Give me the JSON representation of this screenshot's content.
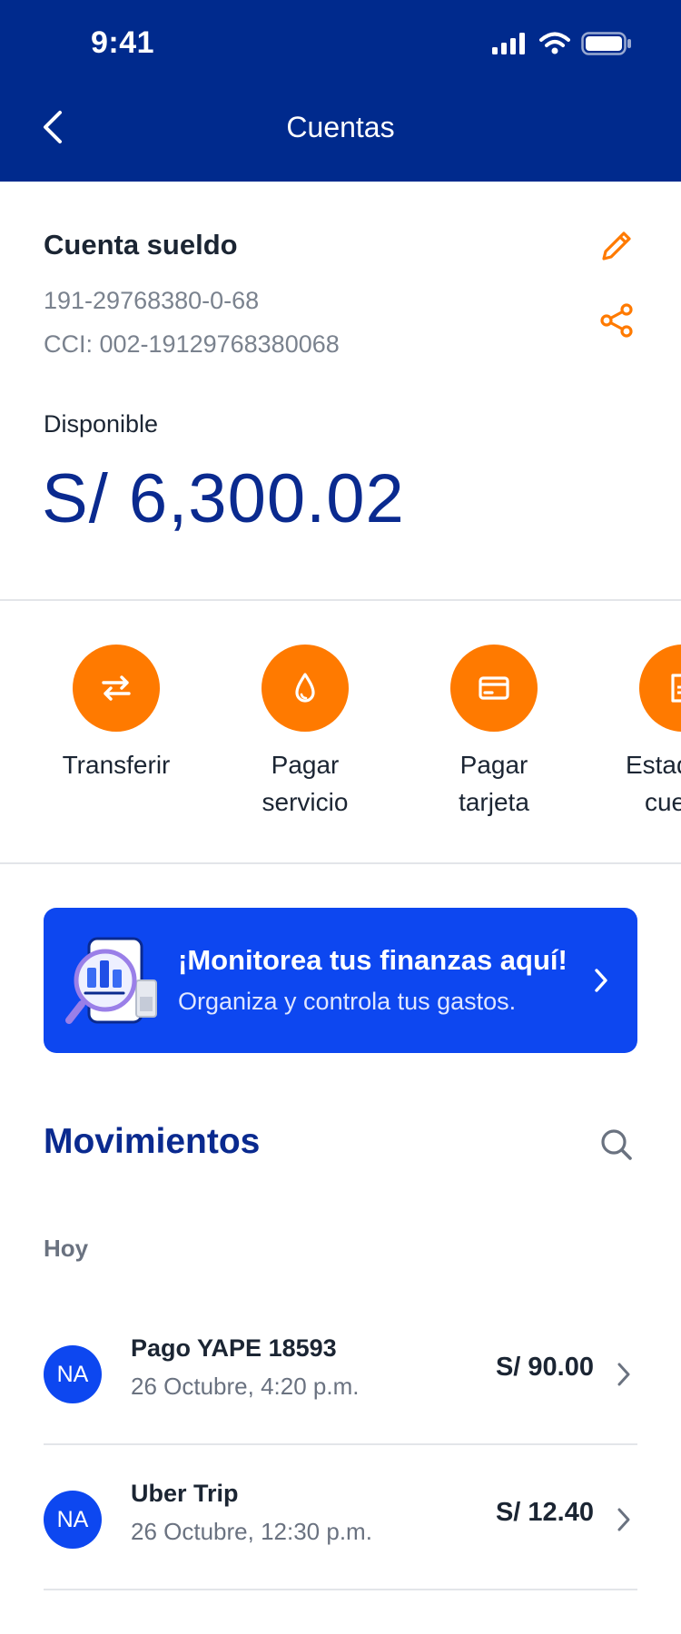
{
  "status_bar": {
    "time": "9:41",
    "icons": [
      "signal-icon",
      "wifi-icon",
      "battery-icon"
    ]
  },
  "header": {
    "title": "Cuentas",
    "back_icon": "chevron-left-icon"
  },
  "account": {
    "name": "Cuenta sueldo",
    "number": "191-29768380-0-68",
    "cci": "CCI: 002-19129768380068",
    "available_label": "Disponible",
    "available_amount": "S/ 6,300.02",
    "edit_icon": "pencil-icon",
    "share_icon": "share-icon"
  },
  "actions": [
    {
      "line1": "Transferir",
      "line2": "",
      "icon": "transfer-icon"
    },
    {
      "line1": "Pagar",
      "line2": "servicio",
      "icon": "drop-icon"
    },
    {
      "line1": "Pagar",
      "line2": "tarjeta",
      "icon": "card-icon"
    },
    {
      "line1": "Estado de",
      "line2": "cuenta",
      "icon": "statement-icon"
    }
  ],
  "banner": {
    "title": "¡Monitorea tus finanzas aquí!",
    "subtitle": "Organiza y controla tus gastos."
  },
  "movements": {
    "title": "Movimientos",
    "group_label": "Hoy",
    "items": [
      {
        "initials": "NA",
        "name": "Pago YAPE 18593",
        "date": "26 Octubre, 4:20 p.m.",
        "amount": "S/ 90.00"
      },
      {
        "initials": "NA",
        "name": "Uber Trip",
        "date": "26 Octubre, 12:30 p.m.",
        "amount": "S/ 12.40"
      }
    ]
  },
  "colors": {
    "header_bg": "#002a8d",
    "accent_orange": "#ff7a00",
    "banner_blue": "#0d47f0",
    "amount_blue": "#0a2a8f"
  }
}
